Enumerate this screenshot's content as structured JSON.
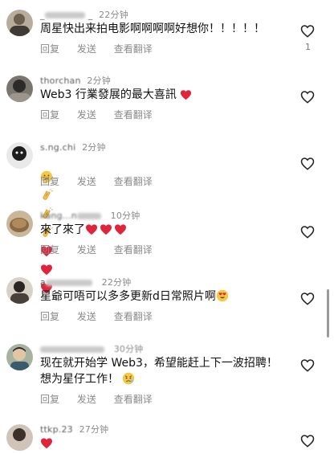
{
  "actions": {
    "reply": "回复",
    "send": "发送",
    "translate": "查看翻译"
  },
  "comments": [
    {
      "username": "_",
      "username_tail": "_",
      "time": "22分钟",
      "text": "周星快出来拍电影啊啊啊啊好想你！！！！！",
      "likes": "1"
    },
    {
      "username": "thorchan",
      "time": "2分钟",
      "text": "Web3 行業發展的最大喜訊"
    },
    {
      "username": "s.ng.chi",
      "time": "2分钟",
      "text": ""
    },
    {
      "username": "kang...n",
      "time": "10分钟",
      "text": "來了來了"
    },
    {
      "username": "a",
      "time": "22分钟",
      "text": "星爺可唔可以多多更新d日常照片啊"
    },
    {
      "username": "",
      "time": "30分钟",
      "text": "现在就开始学 Web3，希望能赶上下一波招聘！\n想为星仔工作！"
    },
    {
      "username": "ttkp.23",
      "time": "27分钟",
      "text": ""
    }
  ],
  "colors": {
    "heart_red": "#e0243b",
    "muted": "#8a8a8a"
  },
  "icons": [
    "heart-outline-icon",
    "red-heart-emoji",
    "clapping-hands-emoji",
    "crying-face-emoji",
    "heart-eyes-emoji",
    "worried-face-emoji"
  ]
}
